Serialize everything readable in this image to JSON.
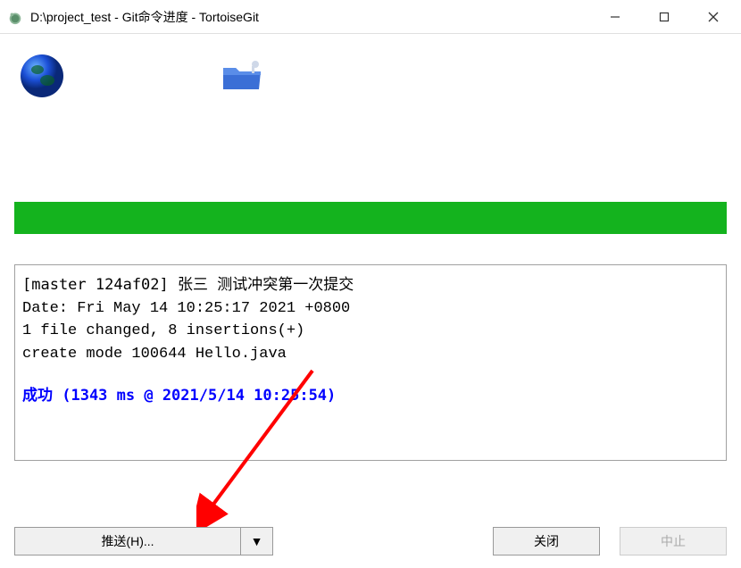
{
  "window": {
    "title": "D:\\project_test - Git命令进度 - TortoiseGit"
  },
  "output": {
    "commit_line": "[master 124af02] 张三 测试冲突第一次提交",
    "date_line": " Date: Fri May 14 10:25:17 2021 +0800",
    "changes_line": " 1 file changed, 8 insertions(+)",
    "create_line": " create mode 100644 Hello.java",
    "success_line": "成功 (1343 ms @ 2021/5/14 10:25:54)"
  },
  "buttons": {
    "push": "推送(H)...",
    "dropdown": "▼",
    "close": "关闭",
    "abort": "中止"
  }
}
